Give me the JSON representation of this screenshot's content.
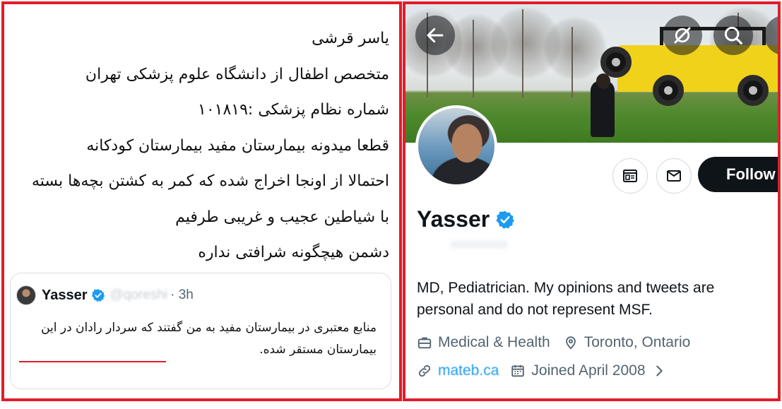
{
  "left_post": {
    "lines": [
      "یاسر قرشی",
      "متخصص اطفال از دانشگاه علوم پزشکی تهران",
      "شماره نظام پزشکی :۱۰۱۸۱۹",
      "قطعا میدونه بیمارستان مفید بیمارستان کودکانه",
      "احتمالا از اونجا اخراج شده که کمر به کشتن بچه‌ها بسته",
      "با شیاطین عجیب و غریبی طرفیم",
      "دشمن هیچگونه شرافتی نداره"
    ],
    "quote": {
      "name": "Yasser",
      "handle": "@qoreshi",
      "time": "· 3h",
      "text": "منابع معتبری در بیمارستان مفید به من گفتند که سردار رادان در این بیمارستان مستقر شده."
    }
  },
  "profile": {
    "name": "Yasser",
    "follow_label": "Follow",
    "bio": "MD, Pediatrician. My opinions and tweets are personal and do not represent MSF.",
    "category": "Medical & Health",
    "location": "Toronto, Ontario",
    "website": "mateb.ca",
    "joined": "Joined April 2008"
  },
  "icons": {
    "back": "arrow-left-icon",
    "hide": "eye-slash-icon",
    "search": "search-icon",
    "subscribe": "newsletter-icon",
    "message": "mail-icon",
    "briefcase": "briefcase-icon",
    "location": "location-pin-icon",
    "link": "link-icon",
    "calendar": "calendar-icon",
    "chevron": "chevron-right-icon"
  },
  "colors": {
    "frame_red": "#e11d2a",
    "verified_blue": "#1d9bf0",
    "follow_bg": "#0f1419",
    "muted_text": "#536471"
  }
}
